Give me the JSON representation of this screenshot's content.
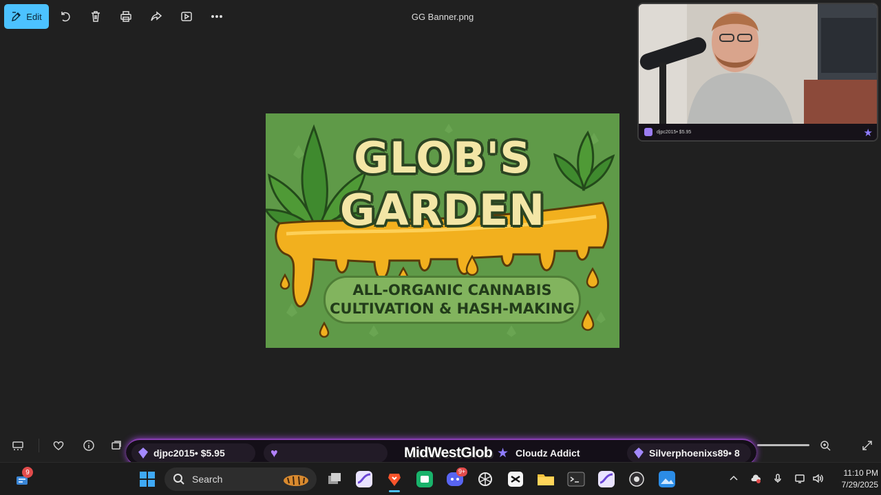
{
  "toolbar": {
    "edit_label": "Edit",
    "file_title": "GG Banner.png",
    "icons": [
      "edit-icon",
      "rotate-icon",
      "delete-icon",
      "print-icon",
      "share-icon",
      "slideshow-icon",
      "more-icon"
    ]
  },
  "banner": {
    "title_line1": "GLOB'S",
    "title_line2": "GARDEN",
    "subtitle_line1": "ALL-ORGANIC CANNABIS",
    "subtitle_line2": "CULTIVATION & HASH-MAKING"
  },
  "webcam": {
    "caption": "djpc2015• $5.95"
  },
  "ticker": {
    "item1": "djpc2015• $5.95",
    "brand": "MidWestGlob",
    "item2": "Cloudz Addict",
    "item3": "Silverphoenixs89• 8"
  },
  "taskbar": {
    "search_label": "Search",
    "widget_badge": "9",
    "discord_badge": "9+",
    "time": "11:10 PM",
    "date": "7/29/2025"
  },
  "colors": {
    "accent": "#4cc2ff",
    "background": "#202020",
    "ticker_glow": "#9b45d6",
    "banner_green": "#5f9a48",
    "banner_cream": "#f3e6a6",
    "honey": "#f2b01e"
  }
}
